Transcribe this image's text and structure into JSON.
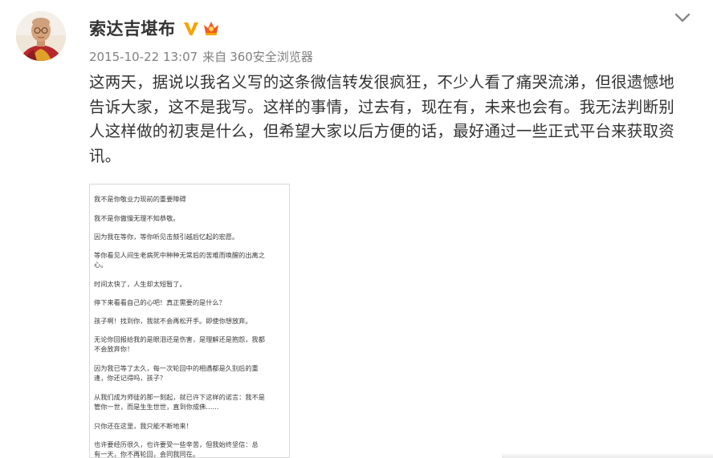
{
  "post": {
    "author": "索达吉堪布",
    "timestamp": "2015-10-22 13:07",
    "from_label": "来自",
    "source": "360安全浏览器",
    "text": "这两天，据说以我名义写的这条微信转发很疯狂，不少人看了痛哭流涕，但很遗憾地告诉大家，这不是我写。这样的事情，过去有，现在有，未来也会有。我无法判断别人这样做的初衷是什么，但希望大家以后方便的话，最好通过一些正式平台来获取资讯。",
    "icons": {
      "verified": "verified-v-badge-icon",
      "member": "member-crown-icon",
      "menu": "chevron-down-icon"
    },
    "colors": {
      "verified": "#f7a300",
      "member": "#f05a24",
      "meta_text": "#808080",
      "body_text": "#333333"
    }
  },
  "image": {
    "lines": [
      "我不是你敬业力现前的重要障碍",
      "我不是你傲慢无理不知恭敬。",
      "因为我在等你，等你听见击鼓引越后忆起的宏愿。",
      "等你看见人间生老病死中种种无常后的苦难而唤醒的出离之",
      "心。",
      "时间太快了，人生却太短暂了。",
      "停下来看看自己的心吧！真正需要的是什么？",
      "孩子啊！找到你，我就不会再松开手。即使你想放弃。",
      "无论你回报给我的是眼泪还是伤害，是理解还是抱怨，我都",
      "不会放弃你！",
      "因为我已等了太久，每一次轮回中的相遇都是久别后的重",
      "逢，你还记得吗，孩子？",
      "从我们成为师徒的那一刻起，就已许下这样的诺言：我不是",
      "管你一世，而是生生世世，直到你成佛……",
      "只你还在这里，我只能不断地来！",
      "也许要经历很久，也许要受一些辛苦，但我始终坚信：总",
      "有一天，你不再轮回，会同我同在。"
    ]
  }
}
